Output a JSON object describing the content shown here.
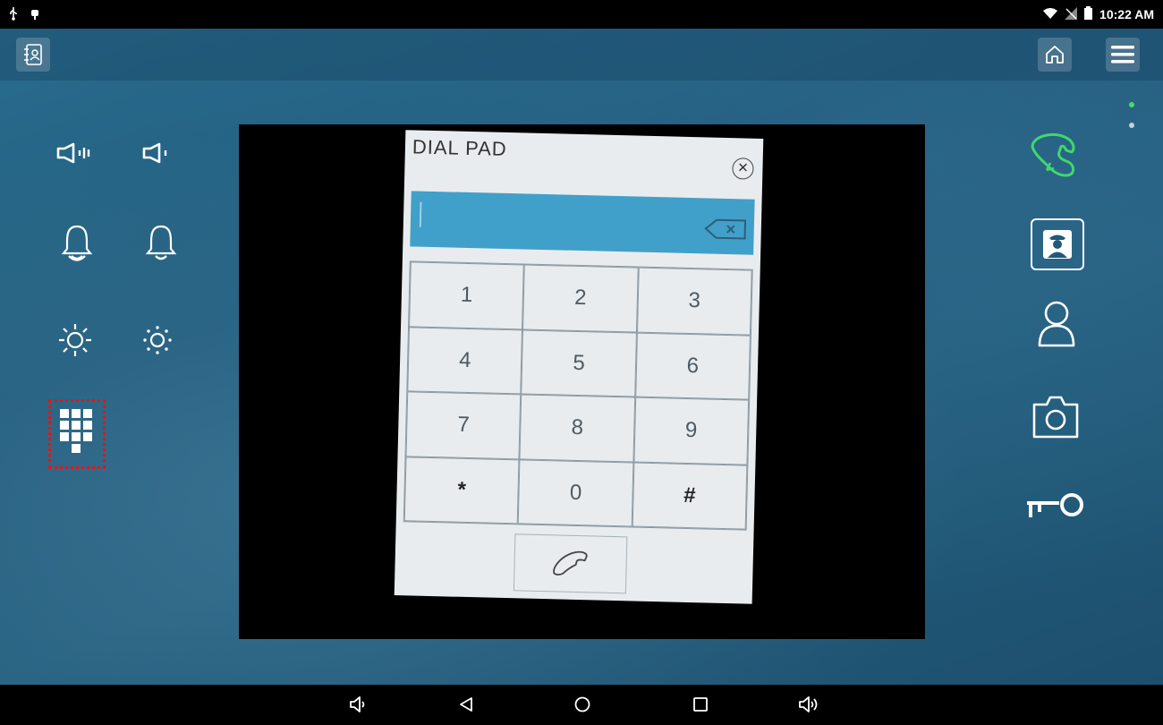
{
  "status_bar": {
    "time": "10:22 AM",
    "icons_left": [
      "usb-icon",
      "android-debug-icon"
    ],
    "icons_right": [
      "wifi-icon",
      "no-sim-icon",
      "battery-icon"
    ]
  },
  "top_bar": {
    "left_button": "contacts-book-icon",
    "right_buttons": [
      "home-icon",
      "menu-icon"
    ]
  },
  "left_controls": [
    {
      "name": "speaker-volume-up-icon"
    },
    {
      "name": "speaker-volume-down-icon"
    },
    {
      "name": "ring-volume-up-icon"
    },
    {
      "name": "ring-volume-down-icon"
    },
    {
      "name": "brightness-up-icon"
    },
    {
      "name": "brightness-down-icon"
    },
    {
      "name": "keypad-icon"
    }
  ],
  "right_controls": [
    {
      "name": "answer-call-icon",
      "color": "#3fd86a"
    },
    {
      "name": "concierge-icon"
    },
    {
      "name": "user-icon"
    },
    {
      "name": "camera-icon"
    },
    {
      "name": "door-key-icon"
    }
  ],
  "dial_pad": {
    "title": "DIAL PAD",
    "close_symbol": "✕",
    "input_value": "",
    "keys": [
      "1",
      "2",
      "3",
      "4",
      "5",
      "6",
      "7",
      "8",
      "9",
      "*",
      "0",
      "#"
    ]
  },
  "pager": {
    "active_color": "#4cd964",
    "inactive_color": "#c8d0d6"
  },
  "nav_bar": [
    "volume-down-icon",
    "back-icon",
    "home-circle-icon",
    "recents-icon",
    "volume-up-icon"
  ]
}
